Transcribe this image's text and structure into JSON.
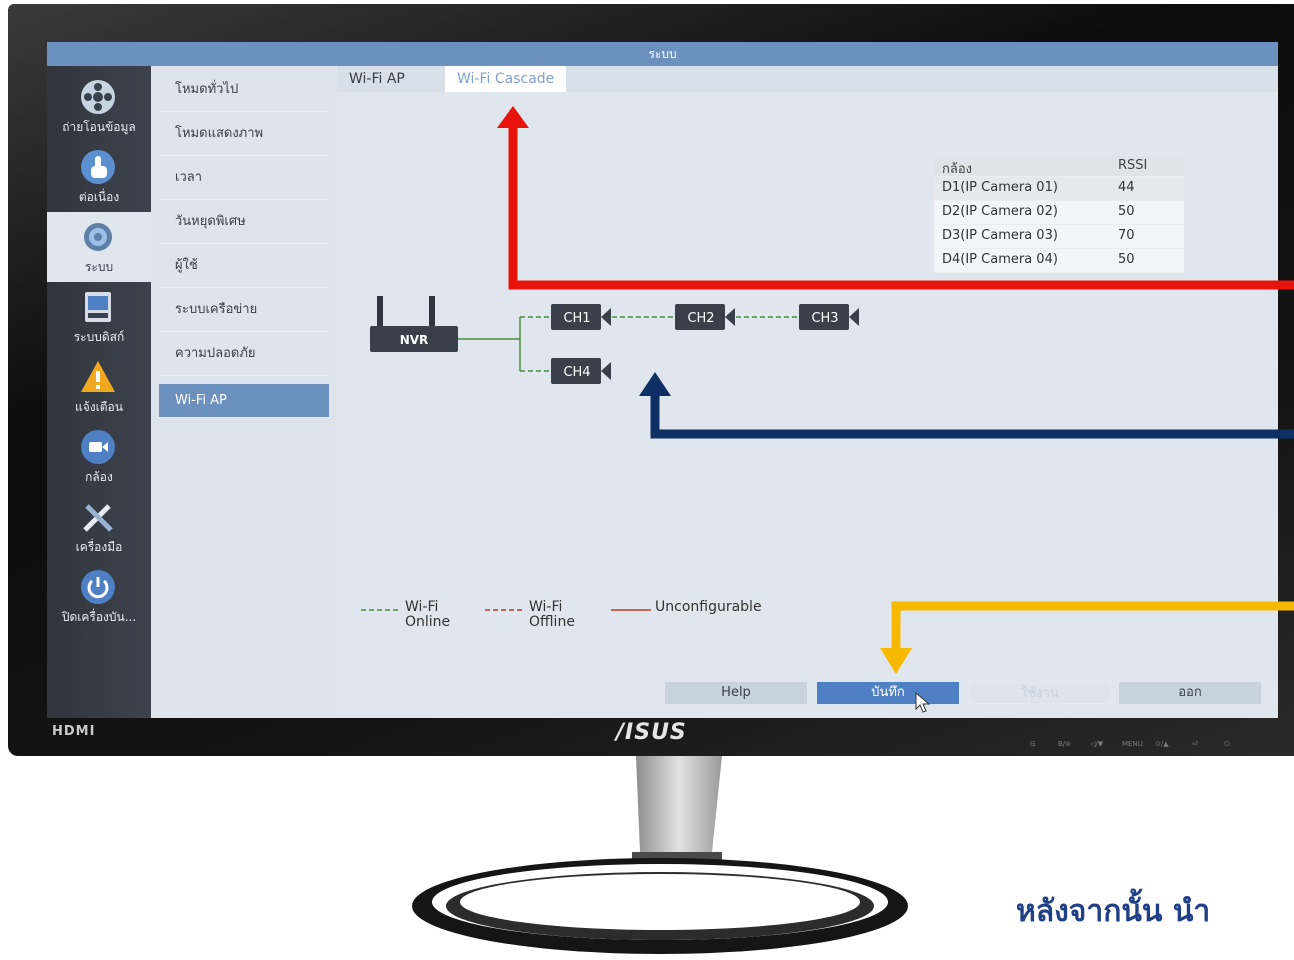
{
  "window": {
    "title": "ระบบ"
  },
  "sidebar": {
    "items": [
      {
        "label": "ถ่ายโอนข้อมูล",
        "icon": "film-reel-icon"
      },
      {
        "label": "ต่อเนื่อง",
        "icon": "hand-pointer-icon"
      },
      {
        "label": "ระบบ",
        "icon": "gear-icon"
      },
      {
        "label": "ระบบดิสก์",
        "icon": "disk-icon"
      },
      {
        "label": "แจ้งเตือน",
        "icon": "warning-icon"
      },
      {
        "label": "กล้อง",
        "icon": "camera-icon"
      },
      {
        "label": "เครื่องมือ",
        "icon": "tools-icon"
      },
      {
        "label": "ปิดเครื่องบัน...",
        "icon": "power-icon"
      }
    ],
    "active_index": 2
  },
  "submenu": {
    "items": [
      "โหมดทั่วไป",
      "โหมดแสดงภาพ",
      "เวลา",
      "วันหยุดพิเศษ",
      "ผู้ใช้",
      "ระบบเครือข่าย",
      "ความปลอดภัย",
      "Wi-Fi AP"
    ],
    "active_index": 7
  },
  "tabs": [
    {
      "label": "Wi-Fi AP",
      "active": false
    },
    {
      "label": "Wi-Fi Cascade",
      "active": true
    }
  ],
  "rssi_table": {
    "headers": [
      "กล้อง",
      "RSSI"
    ],
    "rows": [
      {
        "camera": "D1(IP Camera 01)",
        "rssi": "44"
      },
      {
        "camera": "D2(IP Camera 02)",
        "rssi": "50"
      },
      {
        "camera": "D3(IP Camera 03)",
        "rssi": "70"
      },
      {
        "camera": "D4(IP Camera 04)",
        "rssi": "50"
      }
    ]
  },
  "topology": {
    "nvr_label": "NVR",
    "channels": [
      "CH1",
      "CH2",
      "CH3",
      "CH4"
    ]
  },
  "legend": {
    "online": "Wi-Fi\nOnline",
    "offline": "Wi-Fi\nOffline",
    "unconfigurable": "Unconfigurable",
    "online_color": "#4a8a3c",
    "offline_color": "#c0392b",
    "unconfigurable_color": "#c0392b"
  },
  "buttons": {
    "help": "Help",
    "save": "บันทึก",
    "apply": "ใช้งาน",
    "exit": "ออก"
  },
  "monitor": {
    "hdmi": "HDMI",
    "brand": "/ISUS",
    "controls": [
      "⊟",
      "B/⊜",
      "◁/▼",
      "MENU",
      "⊙/▲",
      "⏎",
      "⏻"
    ]
  },
  "caption": "หลังจากนั้น นำ",
  "colors": {
    "accent": "#6d91be",
    "arrow_red": "#e8130c",
    "arrow_navy": "#0d2f63",
    "arrow_yellow": "#f7b900",
    "caption": "#1f3f86"
  }
}
